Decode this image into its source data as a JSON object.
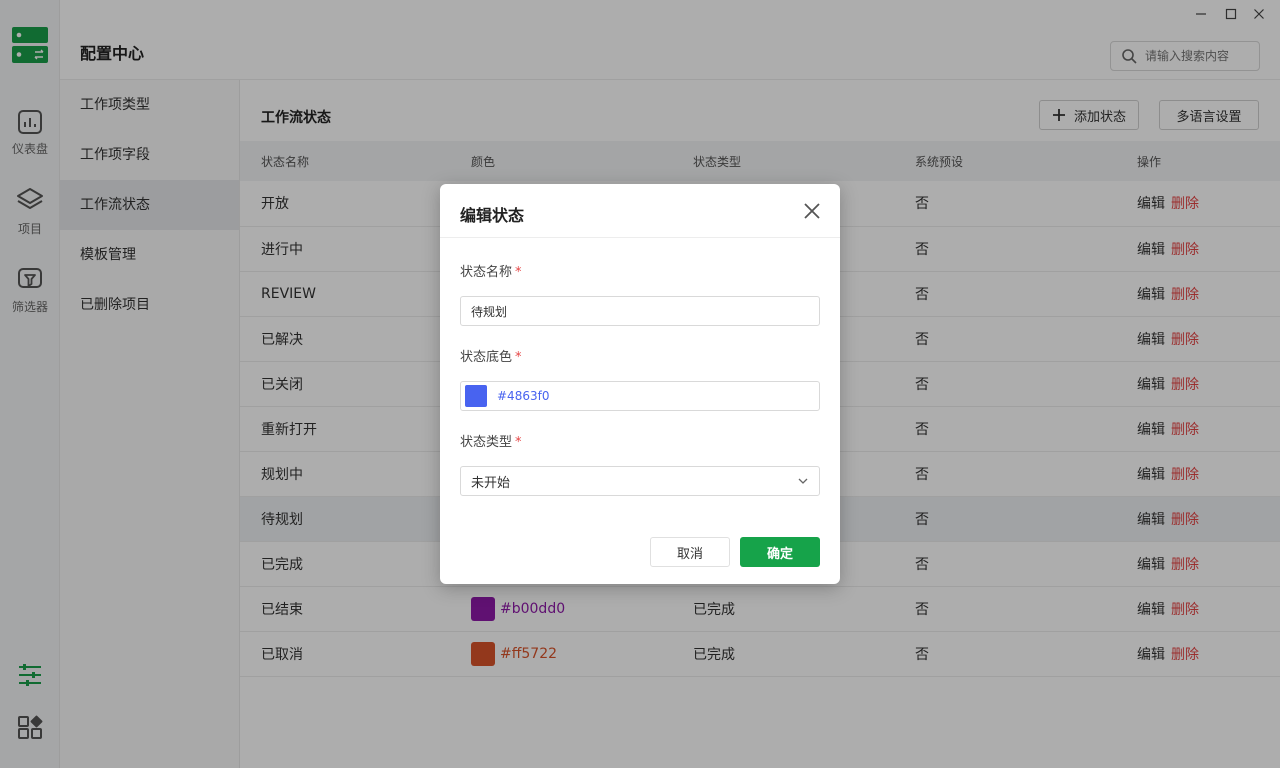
{
  "app": {
    "title": "配置中心"
  },
  "search": {
    "placeholder": "请输入搜索内容"
  },
  "rail": {
    "items": [
      {
        "label": "仪表盘",
        "icon": "chart-icon"
      },
      {
        "label": "项目",
        "icon": "layers-icon"
      },
      {
        "label": "筛选器",
        "icon": "filter-icon"
      }
    ],
    "bottom_icons": [
      "settings-sliders-icon",
      "apps-grid-icon"
    ]
  },
  "subnav": {
    "items": [
      {
        "label": "工作项类型"
      },
      {
        "label": "工作项字段"
      },
      {
        "label": "工作流状态"
      },
      {
        "label": "模板管理"
      },
      {
        "label": "已删除项目"
      }
    ]
  },
  "main": {
    "title": "工作流状态",
    "add_button": "添加状态",
    "lang_button": "多语言设置",
    "columns": [
      "状态名称",
      "颜色",
      "状态类型",
      "系统预设",
      "操作"
    ],
    "rows": [
      {
        "name": "开放",
        "preset": "否"
      },
      {
        "name": "进行中",
        "preset": "否"
      },
      {
        "name": "REVIEW",
        "preset": "否"
      },
      {
        "name": "已解决",
        "preset": "否"
      },
      {
        "name": "已关闭",
        "preset": "否"
      },
      {
        "name": "重新打开",
        "preset": "否"
      },
      {
        "name": "规划中",
        "preset": "否"
      },
      {
        "name": "待规划",
        "preset": "否"
      },
      {
        "name": "已完成",
        "preset": "否"
      },
      {
        "name": "已结束",
        "color": "#b00dd0",
        "type": "已完成",
        "preset": "否"
      },
      {
        "name": "已取消",
        "color": "#ff5722",
        "type": "已完成",
        "preset": "否"
      }
    ],
    "edit_label": "编辑",
    "delete_label": "删除"
  },
  "colors": {
    "accent": "#16a34a",
    "danger": "#e54545",
    "row_9_swatch": "#8e1aa8",
    "row_10_swatch": "#d9532a",
    "row_9_text": "#8e1aa8",
    "row_10_text": "#d9532a"
  },
  "modal": {
    "title": "编辑状态",
    "fields": {
      "name_label": "状态名称",
      "name_value": "待规划",
      "color_label": "状态底色",
      "color_value": "#4863f0",
      "type_label": "状态类型",
      "type_value": "未开始"
    },
    "required_mark": "*",
    "cancel": "取消",
    "confirm": "确定"
  }
}
